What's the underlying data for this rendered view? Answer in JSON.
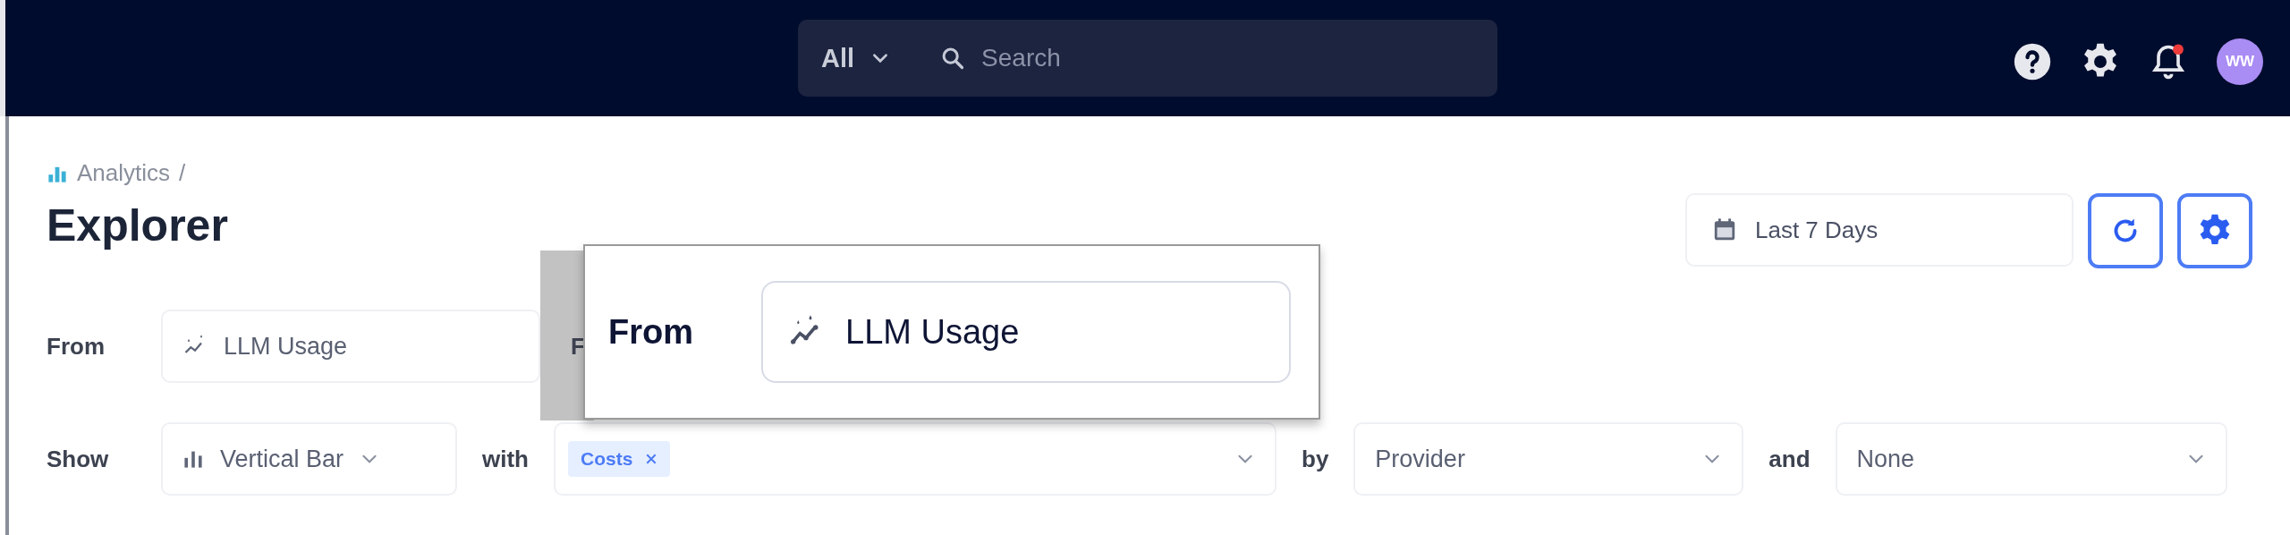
{
  "top_bar": {
    "scope_select": {
      "value": "All"
    },
    "search": {
      "placeholder": "Search"
    },
    "notification_unread": true,
    "avatar": {
      "initials": "WW"
    }
  },
  "breadcrumb": {
    "items": [
      "Analytics"
    ],
    "separator": "/"
  },
  "title": "Explorer",
  "date_range": {
    "value": "Last 7 Days"
  },
  "query": {
    "from": {
      "label": "From",
      "value": "LLM Usage"
    },
    "hidden_label": "F",
    "show": {
      "label": "Show",
      "value": "Vertical Bar"
    },
    "with": {
      "label": "with",
      "chips": [
        "Costs"
      ]
    },
    "by": {
      "label": "by",
      "value": "Provider"
    },
    "and": {
      "label": "and",
      "value": "None"
    }
  },
  "callout": {
    "label": "From",
    "value": "LLM Usage"
  }
}
